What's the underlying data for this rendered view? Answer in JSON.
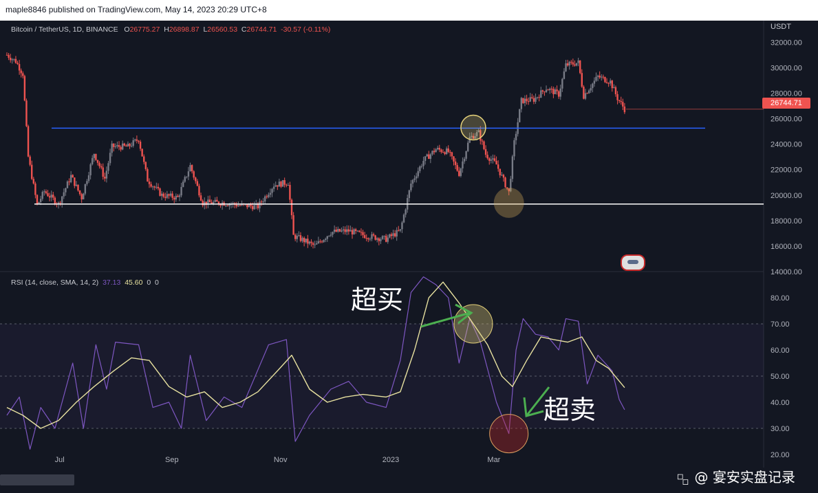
{
  "header": {
    "publish_line": "maple8846 published on TradingView.com, May 14, 2023 20:29 UTC+8"
  },
  "main_legend": {
    "symbol": "Bitcoin / TetherUS, 1D, BINANCE",
    "open_label": "O",
    "open": "26775.27",
    "high_label": "H",
    "high": "26898.87",
    "low_label": "L",
    "low": "26560.53",
    "close_label": "C",
    "close": "26744.71",
    "change": "-30.57 (-0.11%)"
  },
  "rsi_legend": {
    "name": "RSI (14, close, SMA, 14, 2)",
    "rsi": "37.13",
    "ma": "45.60",
    "z1": "0",
    "z2": "0"
  },
  "currency": "USDT",
  "last_price_tag": "26744.71",
  "annotations": {
    "overbought": "超买",
    "oversold": "超卖"
  },
  "watermark": {
    "icon": "diamond-logo-icon",
    "text": "@ 宴安实盘记录"
  },
  "colors": {
    "background": "#131722",
    "up": "#787b86",
    "down": "#ef5350",
    "resistance_line": "#2962ff",
    "support_line": "#ffffff",
    "rsi_line": "#7e57c2",
    "rsi_ma_line": "#e8e2a0",
    "arrow": "#4caf50",
    "highlight_circle": "#e6d27a"
  },
  "chart_data": [
    {
      "type": "candlestick",
      "title": "Bitcoin / TetherUS, 1D, BINANCE",
      "ylabel": "USDT",
      "ylim": [
        14000,
        32500
      ],
      "y_ticks": [
        "14000.00",
        "16000.00",
        "18000.00",
        "20000.00",
        "22000.00",
        "24000.00",
        "26000.00",
        "28000.00",
        "30000.00",
        "32000.00"
      ],
      "x_ticks": [
        "Jul",
        "Sep",
        "Nov",
        "2023",
        "Mar"
      ],
      "x_range": [
        "2022-06-01",
        "2023-05-14"
      ],
      "close_series": [
        [
          "2022-06-01",
          31000
        ],
        [
          "2022-06-06",
          30500
        ],
        [
          "2022-06-10",
          29500
        ],
        [
          "2022-06-13",
          23000
        ],
        [
          "2022-06-18",
          19200
        ],
        [
          "2022-06-22",
          20300
        ],
        [
          "2022-06-30",
          19300
        ],
        [
          "2022-07-07",
          21500
        ],
        [
          "2022-07-13",
          19800
        ],
        [
          "2022-07-20",
          23300
        ],
        [
          "2022-07-26",
          21300
        ],
        [
          "2022-07-30",
          23800
        ],
        [
          "2022-08-08",
          23800
        ],
        [
          "2022-08-14",
          24400
        ],
        [
          "2022-08-19",
          21200
        ],
        [
          "2022-08-27",
          20000
        ],
        [
          "2022-09-05",
          19800
        ],
        [
          "2022-09-12",
          22300
        ],
        [
          "2022-09-19",
          19400
        ],
        [
          "2022-09-30",
          19400
        ],
        [
          "2022-10-10",
          19200
        ],
        [
          "2022-10-20",
          19100
        ],
        [
          "2022-10-29",
          20800
        ],
        [
          "2022-11-06",
          21000
        ],
        [
          "2022-11-09",
          16800
        ],
        [
          "2022-11-14",
          16500
        ],
        [
          "2022-11-21",
          16000
        ],
        [
          "2022-11-30",
          17100
        ],
        [
          "2022-12-10",
          17200
        ],
        [
          "2022-12-20",
          16800
        ],
        [
          "2022-12-31",
          16550
        ],
        [
          "2023-01-08",
          17200
        ],
        [
          "2023-01-14",
          20900
        ],
        [
          "2023-01-21",
          22700
        ],
        [
          "2023-01-28",
          23600
        ],
        [
          "2023-02-04",
          23400
        ],
        [
          "2023-02-10",
          21700
        ],
        [
          "2023-02-16",
          24500
        ],
        [
          "2023-02-21",
          24900
        ],
        [
          "2023-02-25",
          23200
        ],
        [
          "2023-03-03",
          22400
        ],
        [
          "2023-03-10",
          20200
        ],
        [
          "2023-03-13",
          24100
        ],
        [
          "2023-03-17",
          27400
        ],
        [
          "2023-03-24",
          27500
        ],
        [
          "2023-03-31",
          28400
        ],
        [
          "2023-04-07",
          27900
        ],
        [
          "2023-04-11",
          30200
        ],
        [
          "2023-04-18",
          30400
        ],
        [
          "2023-04-21",
          27800
        ],
        [
          "2023-04-29",
          29300
        ],
        [
          "2023-05-06",
          28900
        ],
        [
          "2023-05-10",
          27600
        ],
        [
          "2023-05-14",
          26744.71
        ]
      ],
      "horizontal_lines": [
        {
          "name": "resistance",
          "value": 25250,
          "color": "#2962ff"
        },
        {
          "name": "support",
          "value": 19300,
          "color": "#ffffff"
        }
      ],
      "current_price": 26744.71
    },
    {
      "type": "line",
      "title": "RSI (14, close, SMA, 14, 2)",
      "ylim": [
        15,
        90
      ],
      "y_ticks": [
        "20.00",
        "30.00",
        "40.00",
        "50.00",
        "60.00",
        "70.00",
        "80.00"
      ],
      "bands": [
        30,
        50,
        70
      ],
      "series": [
        {
          "name": "RSI",
          "color": "#7e57c2",
          "values": [
            [
              "2022-06-01",
              35
            ],
            [
              "2022-06-08",
              42
            ],
            [
              "2022-06-14",
              22
            ],
            [
              "2022-06-20",
              38
            ],
            [
              "2022-06-28",
              30
            ],
            [
              "2022-07-08",
              55
            ],
            [
              "2022-07-14",
              30
            ],
            [
              "2022-07-21",
              62
            ],
            [
              "2022-07-27",
              45
            ],
            [
              "2022-08-01",
              63
            ],
            [
              "2022-08-14",
              62
            ],
            [
              "2022-08-22",
              38
            ],
            [
              "2022-08-31",
              40
            ],
            [
              "2022-09-07",
              30
            ],
            [
              "2022-09-12",
              58
            ],
            [
              "2022-09-21",
              33
            ],
            [
              "2022-10-01",
              42
            ],
            [
              "2022-10-11",
              38
            ],
            [
              "2022-10-26",
              62
            ],
            [
              "2022-11-05",
              64
            ],
            [
              "2022-11-10",
              25
            ],
            [
              "2022-11-18",
              35
            ],
            [
              "2022-11-30",
              45
            ],
            [
              "2022-12-10",
              48
            ],
            [
              "2022-12-20",
              40
            ],
            [
              "2022-12-31",
              38
            ],
            [
              "2023-01-08",
              56
            ],
            [
              "2023-01-14",
              82
            ],
            [
              "2023-01-21",
              88
            ],
            [
              "2023-01-28",
              85
            ],
            [
              "2023-02-04",
              80
            ],
            [
              "2023-02-10",
              55
            ],
            [
              "2023-02-16",
              72
            ],
            [
              "2023-02-22",
              63
            ],
            [
              "2023-03-03",
              40
            ],
            [
              "2023-03-10",
              28
            ],
            [
              "2023-03-14",
              60
            ],
            [
              "2023-03-18",
              72
            ],
            [
              "2023-03-25",
              66
            ],
            [
              "2023-04-01",
              65
            ],
            [
              "2023-04-07",
              60
            ],
            [
              "2023-04-11",
              72
            ],
            [
              "2023-04-18",
              71
            ],
            [
              "2023-04-23",
              47
            ],
            [
              "2023-04-29",
              58
            ],
            [
              "2023-05-07",
              52
            ],
            [
              "2023-05-11",
              41
            ],
            [
              "2023-05-14",
              37.13
            ]
          ]
        },
        {
          "name": "RSI-based MA",
          "color": "#e8e2a0",
          "values": [
            [
              "2022-06-01",
              38
            ],
            [
              "2022-06-10",
              35
            ],
            [
              "2022-06-20",
              30
            ],
            [
              "2022-06-30",
              33
            ],
            [
              "2022-07-10",
              40
            ],
            [
              "2022-07-20",
              46
            ],
            [
              "2022-07-31",
              52
            ],
            [
              "2022-08-10",
              57
            ],
            [
              "2022-08-20",
              56
            ],
            [
              "2022-08-31",
              46
            ],
            [
              "2022-09-10",
              42
            ],
            [
              "2022-09-20",
              44
            ],
            [
              "2022-09-30",
              38
            ],
            [
              "2022-10-10",
              40
            ],
            [
              "2022-10-20",
              44
            ],
            [
              "2022-10-31",
              52
            ],
            [
              "2022-11-08",
              58
            ],
            [
              "2022-11-18",
              45
            ],
            [
              "2022-11-28",
              40
            ],
            [
              "2022-12-08",
              42
            ],
            [
              "2022-12-18",
              43
            ],
            [
              "2022-12-31",
              42
            ],
            [
              "2023-01-08",
              44
            ],
            [
              "2023-01-16",
              60
            ],
            [
              "2023-01-24",
              80
            ],
            [
              "2023-02-01",
              86
            ],
            [
              "2023-02-10",
              78
            ],
            [
              "2023-02-18",
              70
            ],
            [
              "2023-02-26",
              62
            ],
            [
              "2023-03-06",
              50
            ],
            [
              "2023-03-12",
              46
            ],
            [
              "2023-03-20",
              56
            ],
            [
              "2023-03-28",
              65
            ],
            [
              "2023-04-04",
              64
            ],
            [
              "2023-04-12",
              63
            ],
            [
              "2023-04-20",
              65
            ],
            [
              "2023-04-28",
              56
            ],
            [
              "2023-05-05",
              53
            ],
            [
              "2023-05-14",
              45.6
            ]
          ]
        }
      ]
    }
  ]
}
